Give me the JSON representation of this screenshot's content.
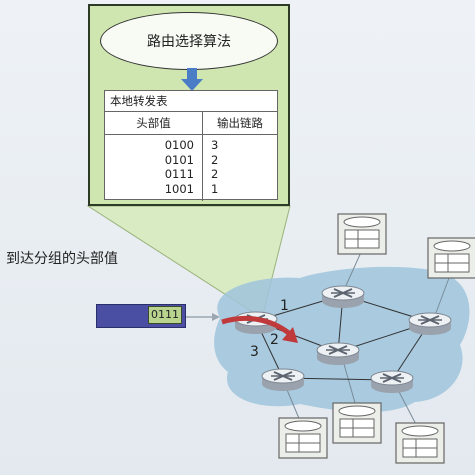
{
  "algorithm": {
    "label": "路由选择算法"
  },
  "forwarding_table": {
    "title": "本地转发表",
    "col_header_value": "头部值",
    "col_output_link": "输出链路",
    "rows": [
      {
        "value": "0100",
        "link": "3"
      },
      {
        "value": "0101",
        "link": "2"
      },
      {
        "value": "0111",
        "link": "2"
      },
      {
        "value": "1001",
        "link": "1"
      }
    ]
  },
  "packet": {
    "caption": "到达分组的头部值",
    "header_value": "0111"
  },
  "links": {
    "l1": "1",
    "l2": "2",
    "l3": "3"
  },
  "colors": {
    "panel": "#cfe6b0",
    "cloud": "#9fc4dc",
    "packet": "#4a4fa3",
    "route_arrow": "#c0393b"
  }
}
